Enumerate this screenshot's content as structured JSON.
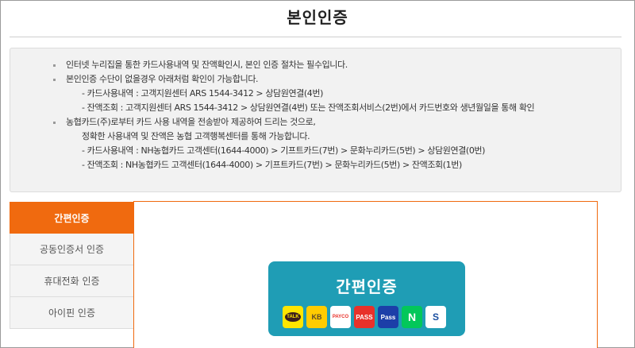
{
  "page_title": "본인인증",
  "notice": {
    "rows": [
      {
        "type": "bullet",
        "text": "인터넷 누리집을 통한 카드사용내역 및 잔액확인시, 본인 인증 절차는 필수입니다."
      },
      {
        "type": "bullet",
        "text": "본인인증 수단이 없을경우 아래처럼 확인이 가능합니다."
      },
      {
        "type": "sub",
        "text": "- 카드사용내역 : 고객지원센터 ARS 1544-3412 > 상담원연결(4번)"
      },
      {
        "type": "sub",
        "text": "- 잔액조회 : 고객지원센터 ARS 1544-3412 > 상담원연결(4번) 또는 잔액조회서비스(2번)에서 카드번호와 생년월일을 통해 확인"
      },
      {
        "type": "bullet",
        "text": "농협카드(주)로부터 카드 사용 내역을 전송받아 제공하여 드리는 것으로,"
      },
      {
        "type": "plain",
        "text": "정확한 사용내역 및 잔액은 농협 고객행복센터를 통해 가능합니다."
      },
      {
        "type": "sub",
        "text": "- 카드사용내역 : NH농협카드 고객센터(1644-4000) > 기프트카드(7번) > 문화누리카드(5번) > 상담원연결(0번)"
      },
      {
        "type": "sub",
        "text": "- 잔액조회 : NH농협카드 고객센터(1644-4000) > 기프트카드(7번) > 문화누리카드(5번) > 잔액조회(1번)"
      }
    ]
  },
  "tabs": [
    {
      "label": "간편인증",
      "active": true
    },
    {
      "label": "공동인증서 인증",
      "active": false
    },
    {
      "label": "휴대전화 인증",
      "active": false
    },
    {
      "label": "아이핀 인증",
      "active": false
    }
  ],
  "easy_auth": {
    "label": "간편인증",
    "icons": [
      {
        "name": "kakao-icon",
        "text": "TALK"
      },
      {
        "name": "kb-icon",
        "text": "KB"
      },
      {
        "name": "payco-icon",
        "text": "PAYCO"
      },
      {
        "name": "pass-icon",
        "text": "PASS"
      },
      {
        "name": "samsung-pass-icon",
        "text": "Pass"
      },
      {
        "name": "naver-icon",
        "text": "N"
      },
      {
        "name": "shinhan-icon",
        "text": "S"
      }
    ]
  },
  "colors": {
    "accent": "#f06a0f",
    "easy_card": "#1f9db5"
  }
}
